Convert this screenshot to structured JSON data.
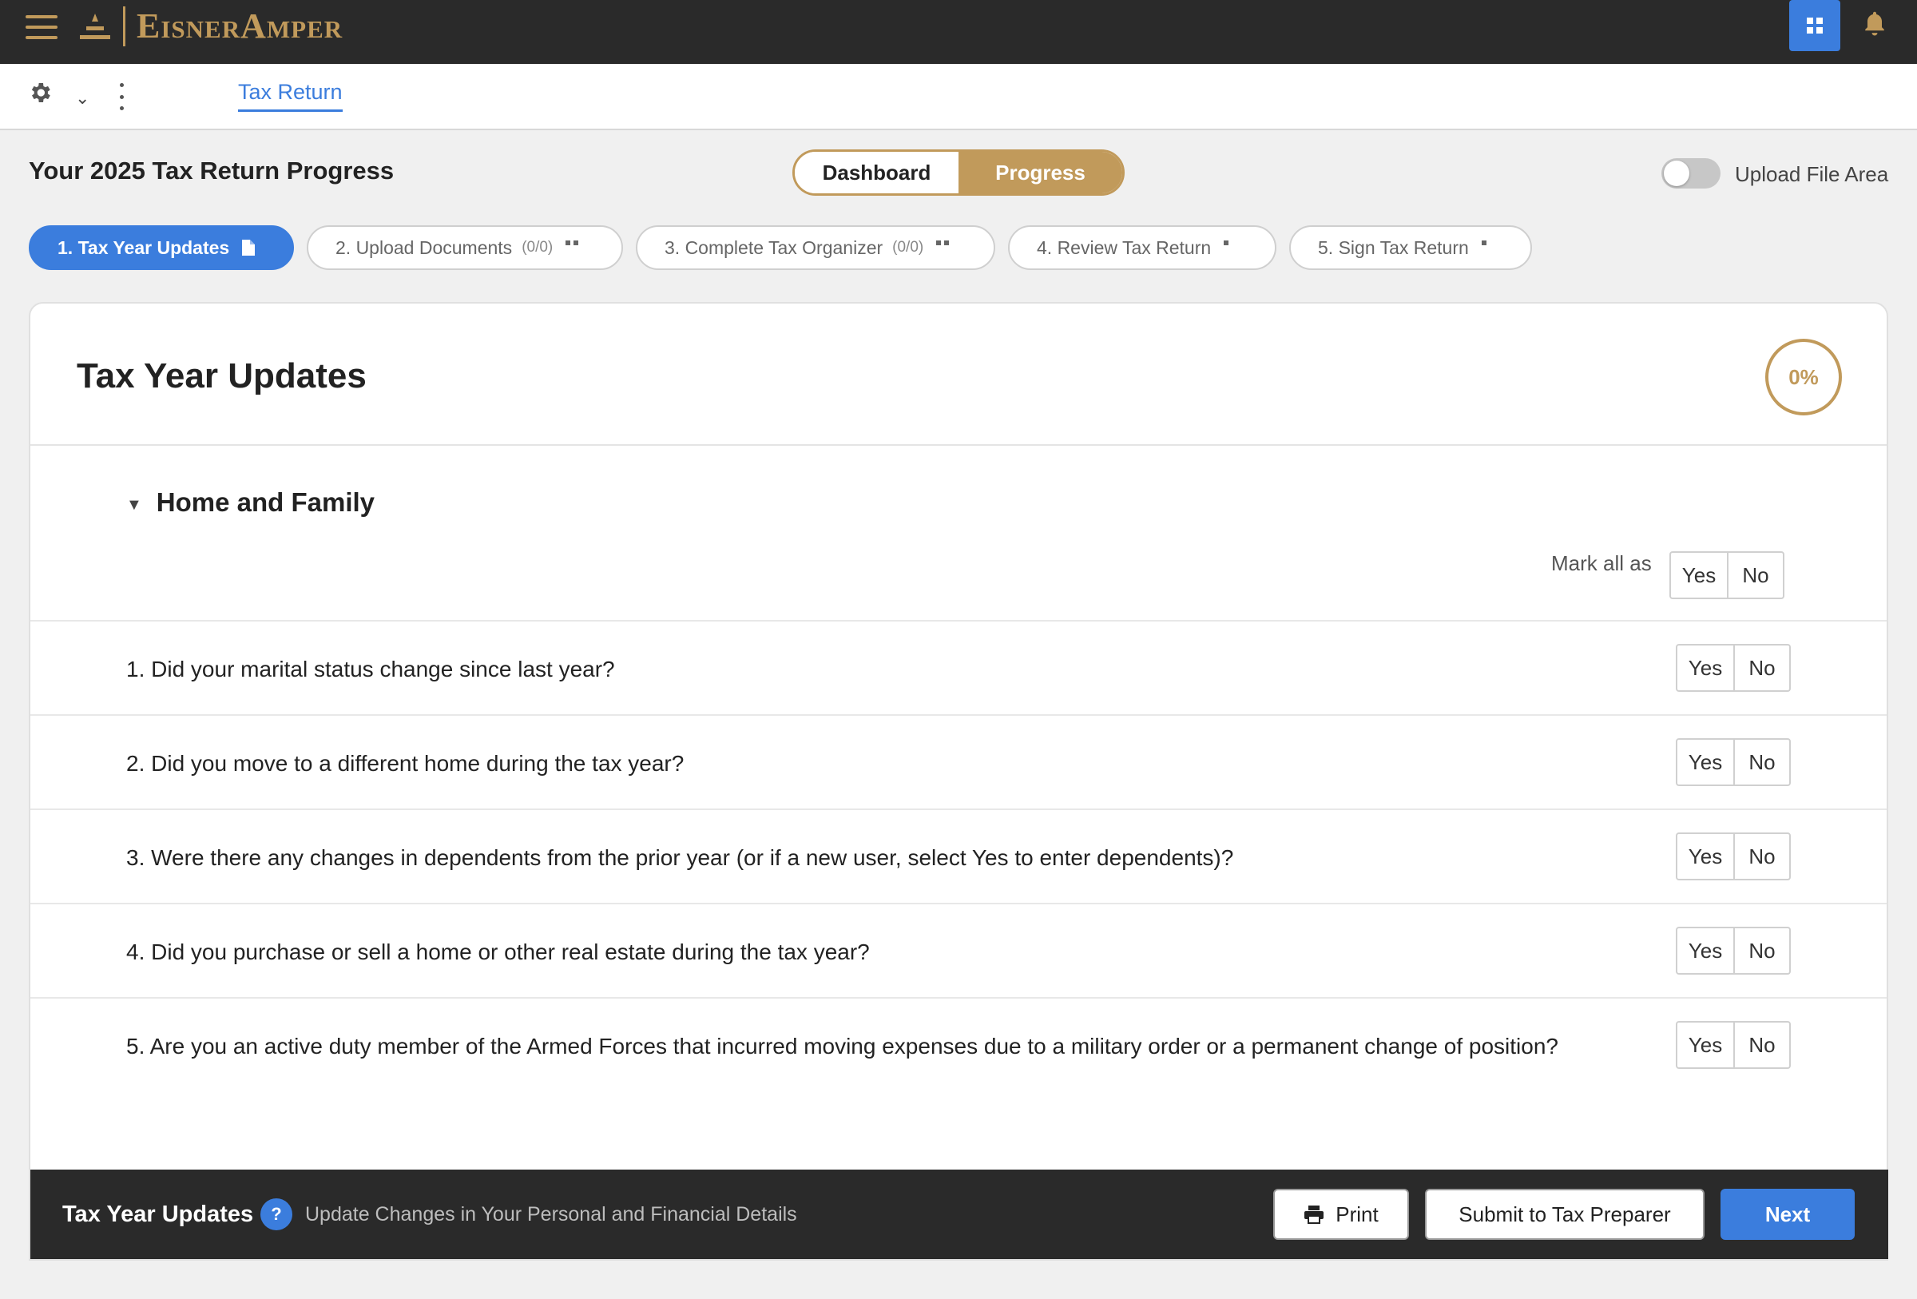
{
  "topbar": {
    "logo_text": "EisnerAmper",
    "icons": {
      "menu": "hamburger-icon",
      "logo": "logo-mark",
      "apps": "grid-icon",
      "notifications": "bell-icon"
    }
  },
  "subbar": {
    "active_tab": "Tax Return",
    "icons": {
      "settings": "gear-icon",
      "expand": "chevron-down-icon",
      "more": "kebab-icon"
    }
  },
  "header": {
    "title": "Your 2025 Tax Return Progress",
    "toggle": {
      "dashboard": "Dashboard",
      "progress": "Progress",
      "selected": "Progress"
    },
    "upload_switch_label": "Upload File Area",
    "upload_switch_on": false
  },
  "steps": [
    {
      "label": "1. Tax Year Updates",
      "count": "",
      "active": true
    },
    {
      "label": "2. Upload Documents",
      "count": "(0/0)",
      "active": false
    },
    {
      "label": "3. Complete Tax Organizer",
      "count": "(0/0)",
      "active": false
    },
    {
      "label": "4. Review Tax Return",
      "count": "",
      "active": false
    },
    {
      "label": "5. Sign Tax Return",
      "count": "",
      "active": false
    }
  ],
  "card": {
    "title": "Tax Year Updates",
    "progress": "0%",
    "section_title": "Home and Family",
    "mark_all_label": "Mark all as",
    "yes": "Yes",
    "no": "No",
    "questions": [
      "1. Did your marital status change since last year?",
      "2. Did you move to a different home during the tax year?",
      "3. Were there any changes in dependents from the prior year (or if a new user, select Yes to enter dependents)?",
      "4. Did you purchase or sell a home or other real estate during the tax year?",
      "5. Are you an active duty member of the Armed Forces that incurred moving expenses due to a military order or a permanent change of position?"
    ]
  },
  "footer": {
    "title": "Tax Year Updates",
    "help": "?",
    "subtitle": "Update Changes in Your Personal and Financial Details",
    "print": "Print",
    "submit": "Submit to Tax Preparer",
    "next": "Next"
  },
  "colors": {
    "brand_gold": "#c19a5b",
    "accent_blue": "#3b7ddd",
    "dark_bar": "#2a2a2a",
    "page_bg": "#f0f0f0"
  }
}
